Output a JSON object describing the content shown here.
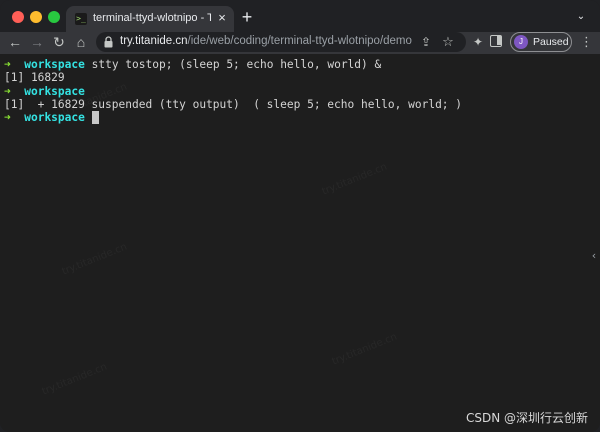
{
  "tab": {
    "title": "terminal-ttyd-wlotnipo - Titanl",
    "favicon": ">_",
    "close_glyph": "×"
  },
  "new_tab_glyph": "+",
  "tab_menu_glyph": "⌄",
  "toolbar": {
    "back_glyph": "←",
    "forward_glyph": "→",
    "reload_glyph": "↻",
    "home_glyph": "⌂",
    "share_glyph": "⇪",
    "star_glyph": "☆",
    "extensions_glyph": "✦",
    "menu_glyph": "⋮"
  },
  "address": {
    "host": "try.titanide.cn",
    "path": "/ide/web/coding/terminal-ttyd-wlotnipo/demo"
  },
  "profile": {
    "initial": "J",
    "label": "Paused"
  },
  "terminal": {
    "prompt_arrow": "➜",
    "prompt_dir": "workspace",
    "command1": "stty tostop; (sleep 5; echo hello, world) &",
    "output1": "[1] 16829",
    "output2": "[1]  + 16829 suspended (tty output)  ( sleep 5; echo hello, world; )"
  },
  "side_handle_glyph": "‹",
  "watermark_faint": "try.titanide.cn",
  "watermark": "CSDN @深圳行云创新",
  "colors": {
    "prompt_arrow": "#8ae234",
    "prompt_dir": "#34e2e2",
    "terminal_bg": "#1e1e1e",
    "terminal_fg": "#d4d4d4"
  }
}
